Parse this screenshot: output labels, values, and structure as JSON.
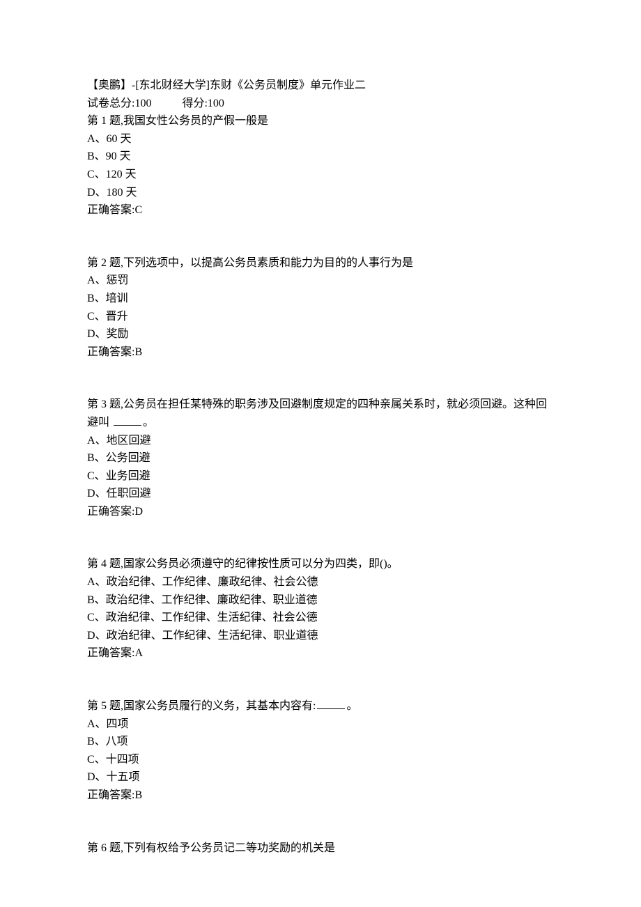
{
  "header": {
    "title": "【奥鹏】-[东北财经大学]东财《公务员制度》单元作业二",
    "scoreTotalLabel": "试卷总分:100",
    "scoreGotLabel": "得分:100"
  },
  "questions": [
    {
      "prompt": "第 1 题,我国女性公务员的产假一般是",
      "options": [
        "A、60 天",
        "B、90 天",
        "C、120 天",
        "D、180 天"
      ],
      "answer": "正确答案:C"
    },
    {
      "prompt": "第 2 题,下列选项中，以提高公务员素质和能力为目的的人事行为是",
      "options": [
        "A、惩罚",
        "B、培训",
        "C、晋升",
        "D、奖励"
      ],
      "answer": "正确答案:B"
    },
    {
      "promptPart1": "第 3 题,公务员在担任某特殊的职务涉及回避制度规定的四种亲属关系时，就必须回避。这种回避叫 ",
      "promptPart2": "。",
      "hasBlank": true,
      "options": [
        "A、地区回避",
        "B、公务回避",
        "C、业务回避",
        "D、任职回避"
      ],
      "answer": "正确答案:D"
    },
    {
      "prompt": "第 4 题,国家公务员必须遵守的纪律按性质可以分为四类，即()。",
      "options": [
        "A、政治纪律、工作纪律、廉政纪律、社会公德",
        "B、政治纪律、工作纪律、廉政纪律、职业道德",
        "C、政治纪律、工作纪律、生活纪律、社会公德",
        "D、政治纪律、工作纪律、生活纪律、职业道德"
      ],
      "answer": "正确答案:A"
    },
    {
      "promptPart1": "第 5 题,国家公务员履行的义务，其基本内容有:",
      "promptPart2": "。",
      "hasBlank": true,
      "options": [
        "A、四项",
        "B、八项",
        "C、十四项",
        "D、十五项"
      ],
      "answer": "正确答案:B"
    },
    {
      "prompt": "第 6 题,下列有权给予公务员记二等功奖励的机关是"
    }
  ]
}
